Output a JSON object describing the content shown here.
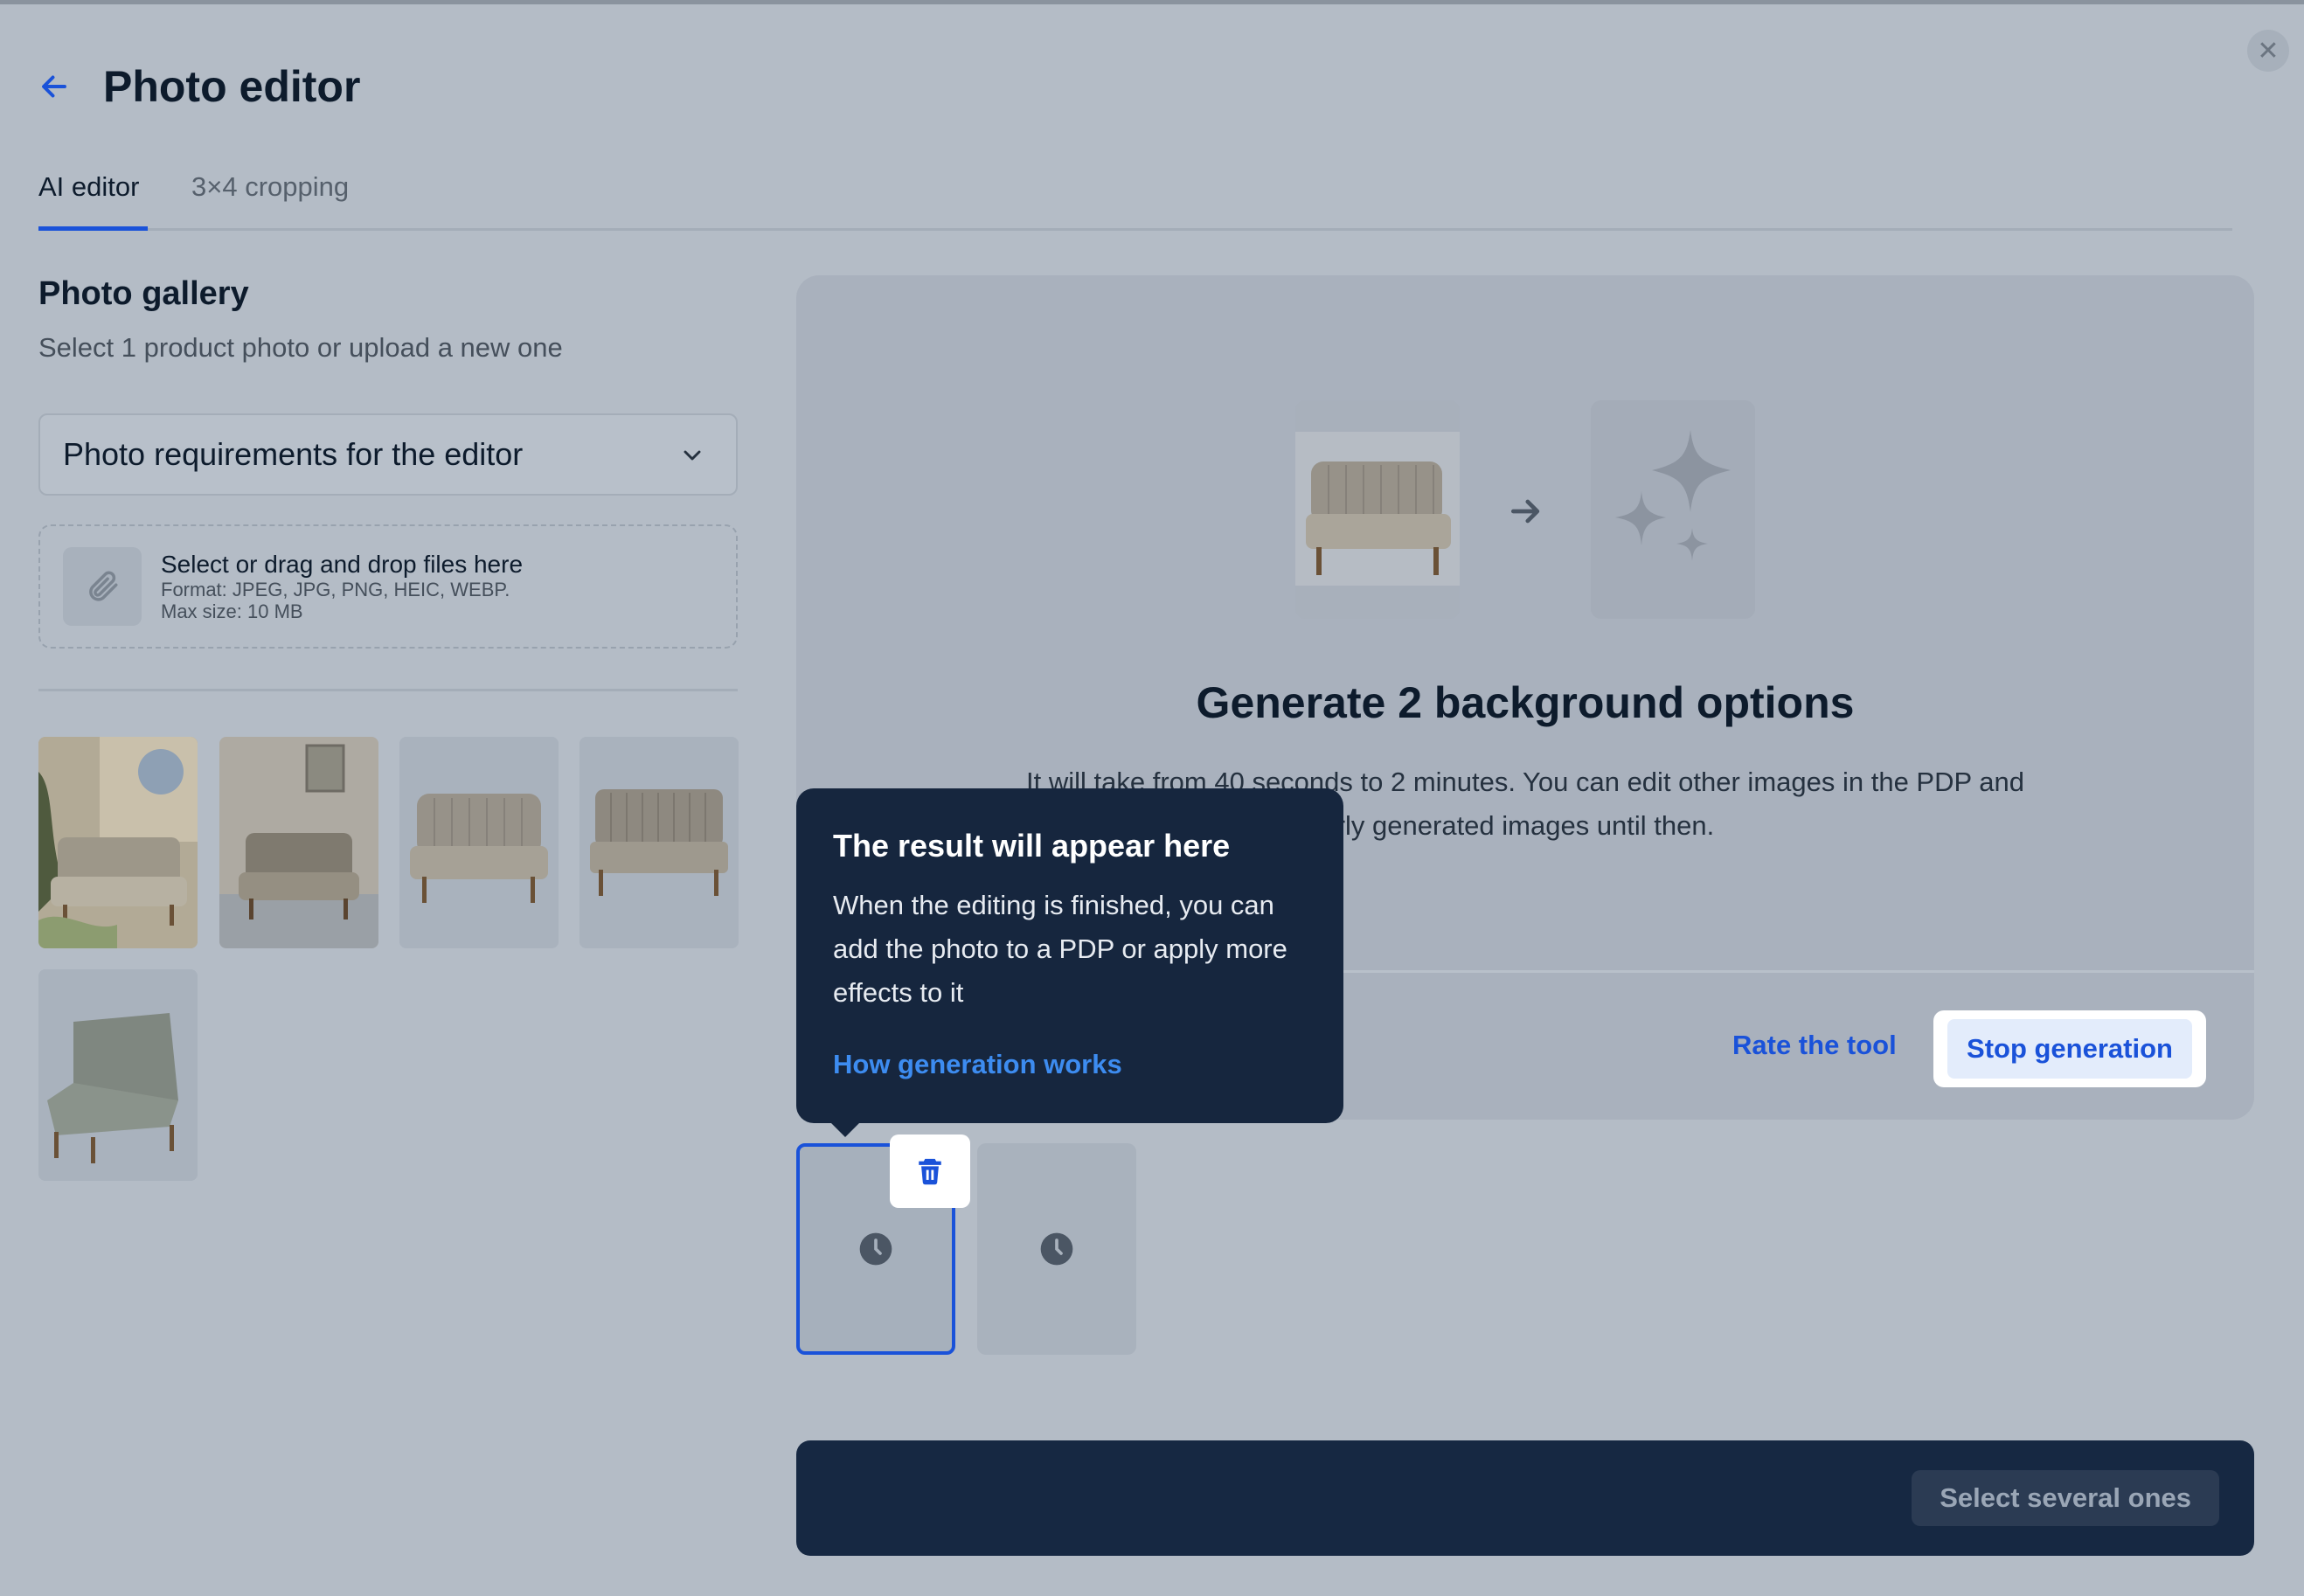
{
  "window": {
    "close_icon": "close-icon"
  },
  "header": {
    "back_icon": "arrow-left-icon",
    "title": "Photo editor"
  },
  "tabs": [
    {
      "label": "AI editor",
      "active": true
    },
    {
      "label": "3×4 cropping",
      "active": false
    }
  ],
  "gallery": {
    "title": "Photo gallery",
    "subtitle": "Select 1 product photo or upload a new one",
    "requirements_label": "Photo requirements for the editor",
    "upload": {
      "title": "Select or drag and drop files here",
      "format": "Format: JPEG, JPG, PNG, HEIC, WEBP.",
      "max_size": "Max size: 10 MB"
    }
  },
  "preview": {
    "title": "Generate 2 background options",
    "description_line1": "It will take from 40 seconds to 2 minutes. You can edit other images in the PDP and",
    "description_line2": "rly generated images until then.",
    "rate_label": "Rate the tool",
    "stop_label": "Stop generation"
  },
  "tooltip": {
    "title": "The result will appear here",
    "body": "When the editing is finished, you can add the photo to a PDP or apply more effects to it",
    "link": "How generation works"
  },
  "bottom_bar": {
    "select_several_label": "Select several ones"
  },
  "colors": {
    "accent": "#1a52d9",
    "dark_navy": "#16263e",
    "overlay": "#b4bcc6"
  }
}
